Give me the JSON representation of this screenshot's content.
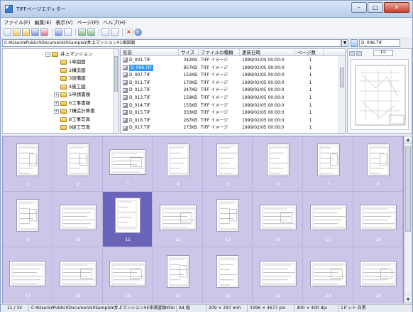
{
  "window": {
    "title": "TIFFページエディター"
  },
  "menu": [
    "ファイル(F)",
    "編集(E)",
    "表示(V)",
    "ページ(P)",
    "ヘルプ(H)"
  ],
  "toolbar": {
    "buttons": [
      "new-icon",
      "open-icon",
      "folder-icon",
      "save-icon",
      "edit-icon",
      "grid-view-icon",
      "list-view-icon",
      "rotate-left-icon",
      "rotate-right-icon",
      "thumbnail-view-icon",
      "dropdown-icon",
      "delete-icon",
      "help-icon"
    ],
    "delete_glyph": "✕"
  },
  "path": {
    "value": "C:¥Users¥Public¥Documents¥Sample¥井上マンション¥1章図面",
    "dropdown_glyph": "▼",
    "filename": "D_006.TIF"
  },
  "tree": {
    "root": "井上マンション",
    "items": [
      {
        "label": "1章図面",
        "expander": ""
      },
      {
        "label": "2構造図",
        "expander": ""
      },
      {
        "label": "3設備図",
        "expander": ""
      },
      {
        "label": "4施工図",
        "expander": ""
      },
      {
        "label": "5申請書類",
        "expander": "+"
      },
      {
        "label": "6工事書類",
        "expander": "+"
      },
      {
        "label": "7構造計算書",
        "expander": "+"
      },
      {
        "label": "8工事写真",
        "expander": ""
      },
      {
        "label": "9竣工写真",
        "expander": ""
      }
    ]
  },
  "filelist": {
    "columns": [
      "名前",
      "サイズ",
      "ファイルの種類",
      "更新日時",
      "ページ数"
    ],
    "rows": [
      {
        "name": "D_001.TIF",
        "size": "342KB",
        "type": "TIFF イメージ",
        "date": "1999/02/05 00:00:0",
        "pages": "1"
      },
      {
        "name": "D_006.TIF",
        "size": "957KB",
        "type": "TIFF イメージ",
        "date": "1999/02/05 00:00:0",
        "pages": "1"
      },
      {
        "name": "D_007.TIF",
        "size": "152KB",
        "type": "TIFF イメージ",
        "date": "1999/02/05 00:00:0",
        "pages": "1"
      },
      {
        "name": "D_011.TIF",
        "size": "170KB",
        "type": "TIFF イメージ",
        "date": "1999/02/05 00:00:0",
        "pages": "1"
      },
      {
        "name": "D_012.TIF",
        "size": "247KB",
        "type": "TIFF イメージ",
        "date": "1999/02/05 00:00:0",
        "pages": "1"
      },
      {
        "name": "D_013.TIF",
        "size": "159KB",
        "type": "TIFF イメージ",
        "date": "1999/02/05 00:00:0",
        "pages": "1"
      },
      {
        "name": "D_014.TIF",
        "size": "155KB",
        "type": "TIFF イメージ",
        "date": "1999/02/05 00:00:0",
        "pages": "1"
      },
      {
        "name": "D_015.TIF",
        "size": "333KB",
        "type": "TIFF イメージ",
        "date": "1999/02/05 00:00:0",
        "pages": "1"
      },
      {
        "name": "D_016.TIF",
        "size": "267KB",
        "type": "TIFF イメージ",
        "date": "1999/02/05 00:00:0",
        "pages": "1"
      },
      {
        "name": "D_017.TIF",
        "size": "273KB",
        "type": "TIFF イメージ",
        "date": "1999/02/05 00:00:0",
        "pages": "1"
      }
    ],
    "selected": 1
  },
  "preview": {
    "page": "1/1"
  },
  "thumbnails": {
    "selected": 11,
    "pages": [
      {
        "n": "1",
        "o": "portrait"
      },
      {
        "n": "2",
        "o": "portrait"
      },
      {
        "n": "3",
        "o": "landscape"
      },
      {
        "n": "4",
        "o": "portrait"
      },
      {
        "n": "5",
        "o": "portrait"
      },
      {
        "n": "6",
        "o": "portrait"
      },
      {
        "n": "7",
        "o": "portrait"
      },
      {
        "n": "8",
        "o": "portrait"
      },
      {
        "n": "9",
        "o": "portrait"
      },
      {
        "n": "10",
        "o": "landscape"
      },
      {
        "n": "11",
        "o": "portrait"
      },
      {
        "n": "12",
        "o": "landscape"
      },
      {
        "n": "13",
        "o": "portrait"
      },
      {
        "n": "14",
        "o": "landscape"
      },
      {
        "n": "15",
        "o": "landscape"
      },
      {
        "n": "16",
        "o": "landscape"
      },
      {
        "n": "17",
        "o": "landscape"
      },
      {
        "n": "18",
        "o": "landscape"
      },
      {
        "n": "19",
        "o": "landscape"
      },
      {
        "n": "20",
        "o": "portrait"
      },
      {
        "n": "21",
        "o": "portrait"
      },
      {
        "n": "22",
        "o": "landscape"
      },
      {
        "n": "23",
        "o": "landscape"
      },
      {
        "n": "24",
        "o": "landscape"
      }
    ]
  },
  "scroll": {
    "up": "▲",
    "down": "▼"
  },
  "status": {
    "page": "11 / 34",
    "path": "C:¥Users¥Public¥Documents¥Sample¥井上マンション¥5申請書類¥Do",
    "paper": "A4 縦",
    "size_mm": "209 × 297 mm",
    "pixels": "3296 × 4677 pix",
    "dpi": "400 × 400 dpi",
    "color": "1ビット 白黒"
  }
}
